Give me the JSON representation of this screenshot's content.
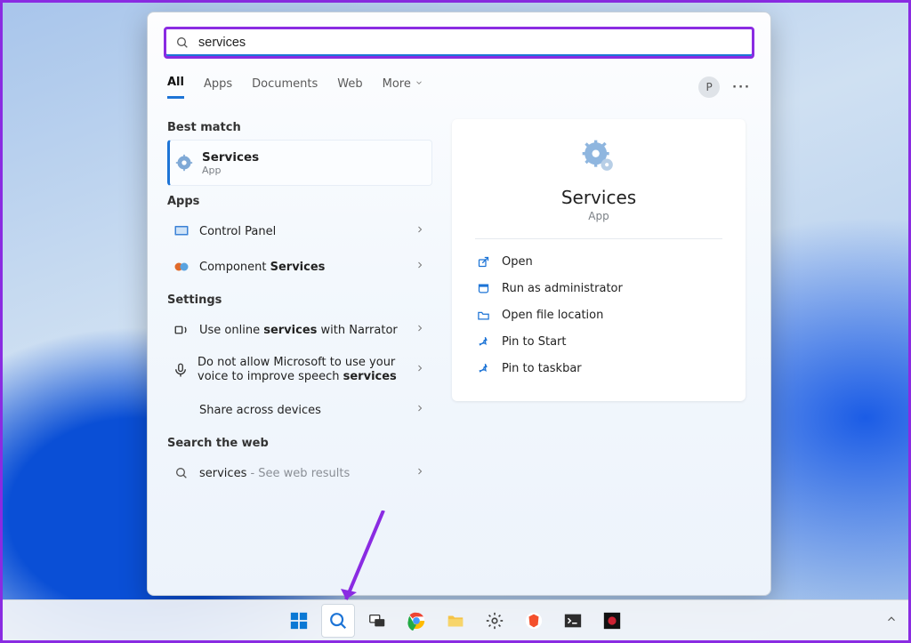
{
  "search": {
    "query": "services"
  },
  "tabs": {
    "all": "All",
    "apps": "Apps",
    "documents": "Documents",
    "web": "Web",
    "more": "More"
  },
  "account_initial": "P",
  "headers": {
    "best_match": "Best match",
    "apps": "Apps",
    "settings": "Settings",
    "search_web": "Search the web"
  },
  "best_match": {
    "title": "Services",
    "type": "App"
  },
  "apps_results": {
    "control_panel": "Control Panel",
    "component_pre": "Component ",
    "component_bold": "Services"
  },
  "settings_results": {
    "narrator_pre": "Use online ",
    "narrator_bold": "services",
    "narrator_post": " with Narrator",
    "speech_pre": "Do not allow Microsoft to use your voice to improve speech ",
    "speech_bold": "services",
    "share": "Share across devices"
  },
  "web_results": {
    "term": "services",
    "suffix": " - See web results"
  },
  "details": {
    "title": "Services",
    "type": "App"
  },
  "actions": {
    "open": "Open",
    "run_admin": "Run as administrator",
    "open_location": "Open file location",
    "pin_start": "Pin to Start",
    "pin_taskbar": "Pin to taskbar"
  }
}
